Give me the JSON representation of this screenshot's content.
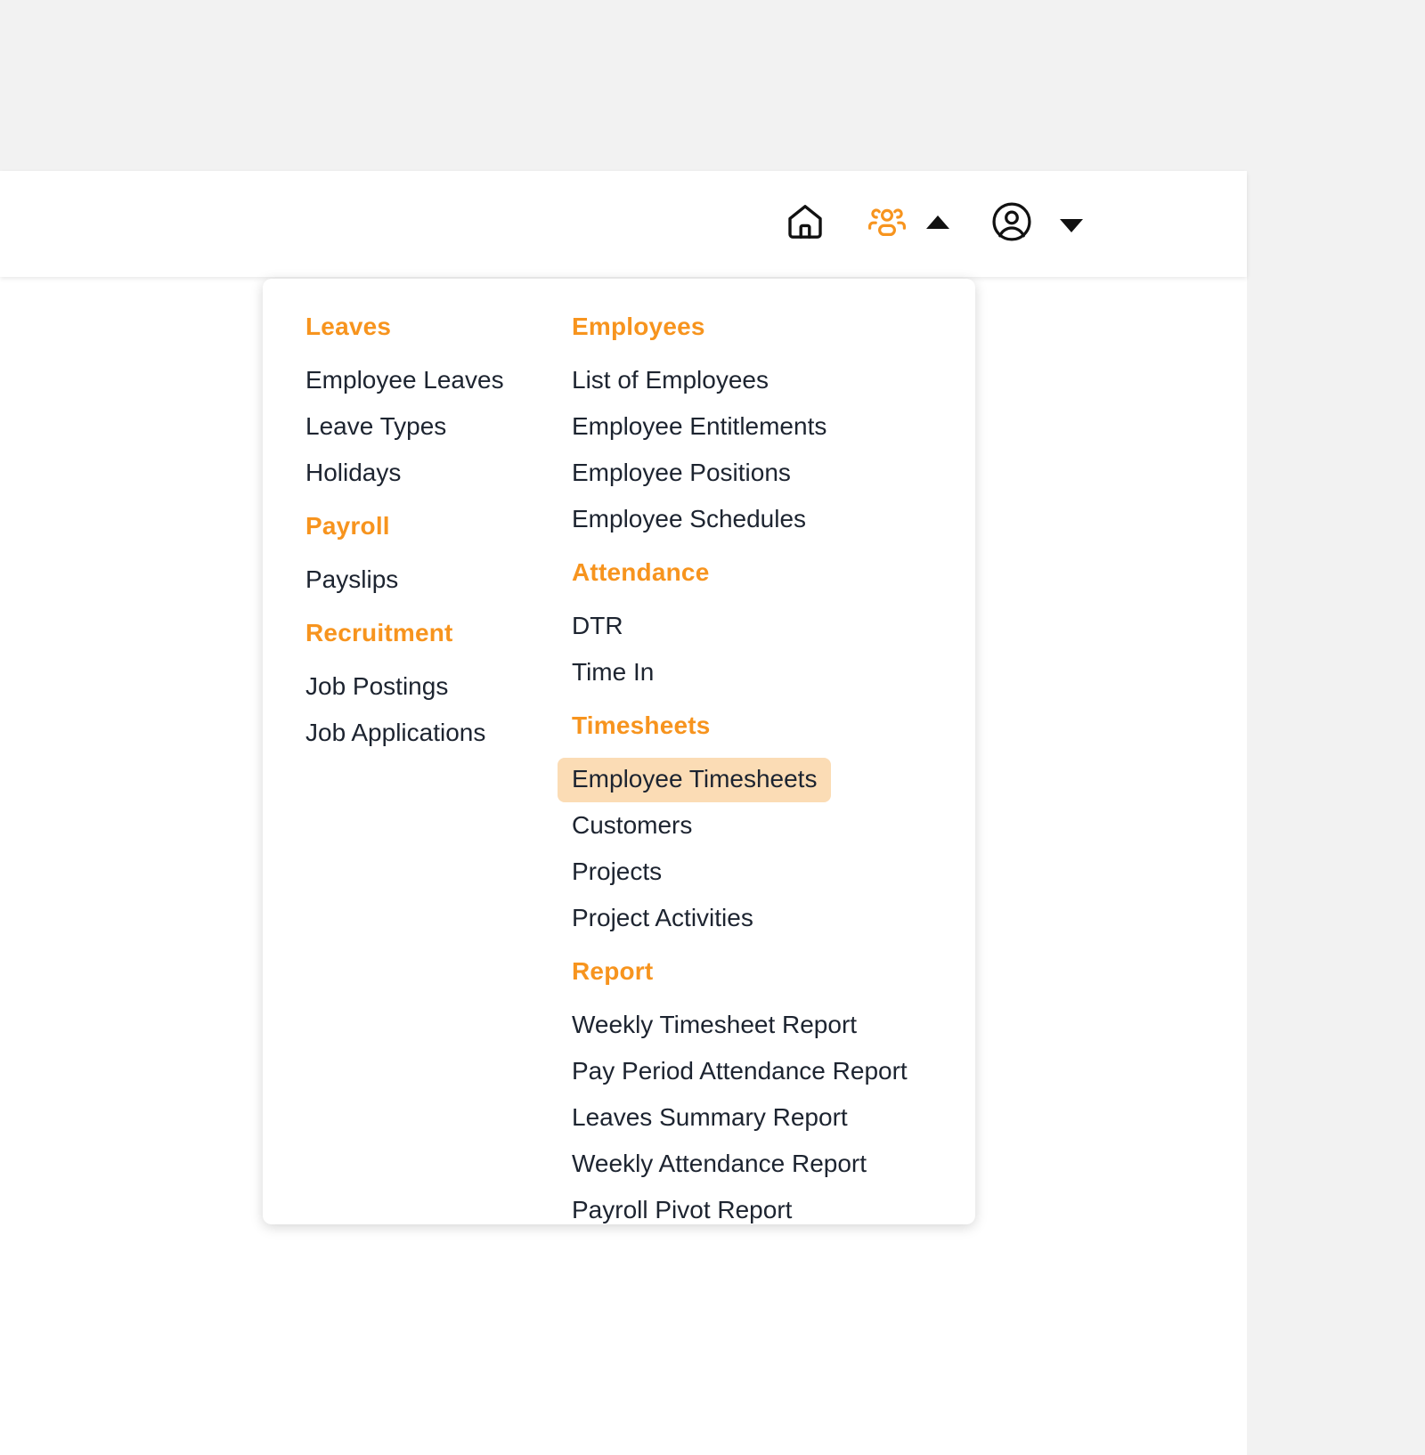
{
  "topbar": {
    "icons": [
      {
        "name": "home-icon",
        "label": "Home"
      },
      {
        "name": "people-icon",
        "label": "HR Module"
      },
      {
        "name": "caret-up-icon",
        "label": "Collapse menu"
      },
      {
        "name": "user-account-icon",
        "label": "Account"
      },
      {
        "name": "caret-down-icon",
        "label": "Account menu"
      }
    ]
  },
  "colors": {
    "accent": "#f7941e",
    "active_bg": "#fbdcb5",
    "text": "#1d2430",
    "page_bg": "#f2f2f2",
    "panel_bg": "#ffffff"
  },
  "menu": {
    "left_column": [
      {
        "title": "Leaves",
        "items": [
          {
            "label": "Employee Leaves",
            "active": false
          },
          {
            "label": "Leave Types",
            "active": false
          },
          {
            "label": "Holidays",
            "active": false
          }
        ]
      },
      {
        "title": "Payroll",
        "items": [
          {
            "label": "Payslips",
            "active": false
          }
        ]
      },
      {
        "title": "Recruitment",
        "items": [
          {
            "label": "Job Postings",
            "active": false
          },
          {
            "label": "Job Applications",
            "active": false
          }
        ]
      }
    ],
    "right_column": [
      {
        "title": "Employees",
        "items": [
          {
            "label": "List of Employees",
            "active": false
          },
          {
            "label": "Employee Entitlements",
            "active": false
          },
          {
            "label": "Employee Positions",
            "active": false
          },
          {
            "label": "Employee Schedules",
            "active": false
          }
        ]
      },
      {
        "title": "Attendance",
        "items": [
          {
            "label": "DTR",
            "active": false
          },
          {
            "label": "Time In",
            "active": false
          }
        ]
      },
      {
        "title": "Timesheets",
        "items": [
          {
            "label": "Employee Timesheets",
            "active": true
          },
          {
            "label": "Customers",
            "active": false
          },
          {
            "label": "Projects",
            "active": false
          },
          {
            "label": "Project Activities",
            "active": false
          }
        ]
      },
      {
        "title": "Report",
        "items": [
          {
            "label": "Weekly Timesheet Report",
            "active": false
          },
          {
            "label": "Pay Period Attendance Report",
            "active": false
          },
          {
            "label": "Leaves Summary Report",
            "active": false
          },
          {
            "label": "Weekly Attendance Report",
            "active": false
          },
          {
            "label": "Payroll Pivot Report",
            "active": false
          }
        ]
      }
    ]
  }
}
